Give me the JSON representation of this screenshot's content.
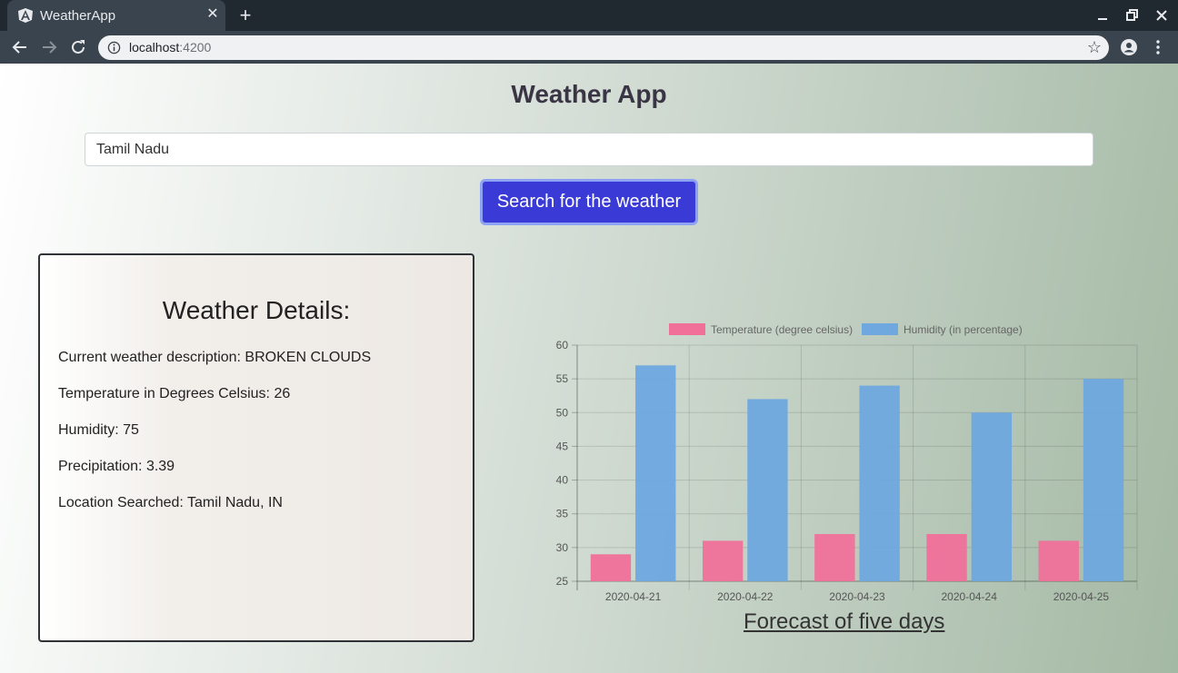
{
  "browser": {
    "tab_title": "WeatherApp",
    "url_host": "localhost",
    "url_port": ":4200"
  },
  "app": {
    "title": "Weather App",
    "search": {
      "value": "Tamil Nadu",
      "button_label": "Search for the weather"
    },
    "details": {
      "heading": "Weather Details:",
      "description": "Current weather description: BROKEN CLOUDS",
      "temperature": "Temperature in Degrees Celsius: 26",
      "humidity": "Humidity: 75",
      "precipitation": "Precipitation: 3.39",
      "location": "Location Searched: Tamil Nadu, IN"
    },
    "chart_caption": "Forecast of five days"
  },
  "colors": {
    "temperature": "#f0709a",
    "humidity": "#6ea8df",
    "button": "#3a3ad6"
  },
  "chart_data": {
    "type": "bar",
    "categories": [
      "2020-04-21",
      "2020-04-22",
      "2020-04-23",
      "2020-04-24",
      "2020-04-25"
    ],
    "series": [
      {
        "name": "Temperature (degree celsius)",
        "values": [
          29,
          31,
          32,
          32,
          31
        ]
      },
      {
        "name": "Humidity (in percentage)",
        "values": [
          57,
          52,
          54,
          50,
          55
        ]
      }
    ],
    "ylim": [
      25,
      60
    ],
    "yticks": [
      25,
      30,
      35,
      40,
      45,
      50,
      55,
      60
    ],
    "grid": true,
    "legend": "top"
  }
}
